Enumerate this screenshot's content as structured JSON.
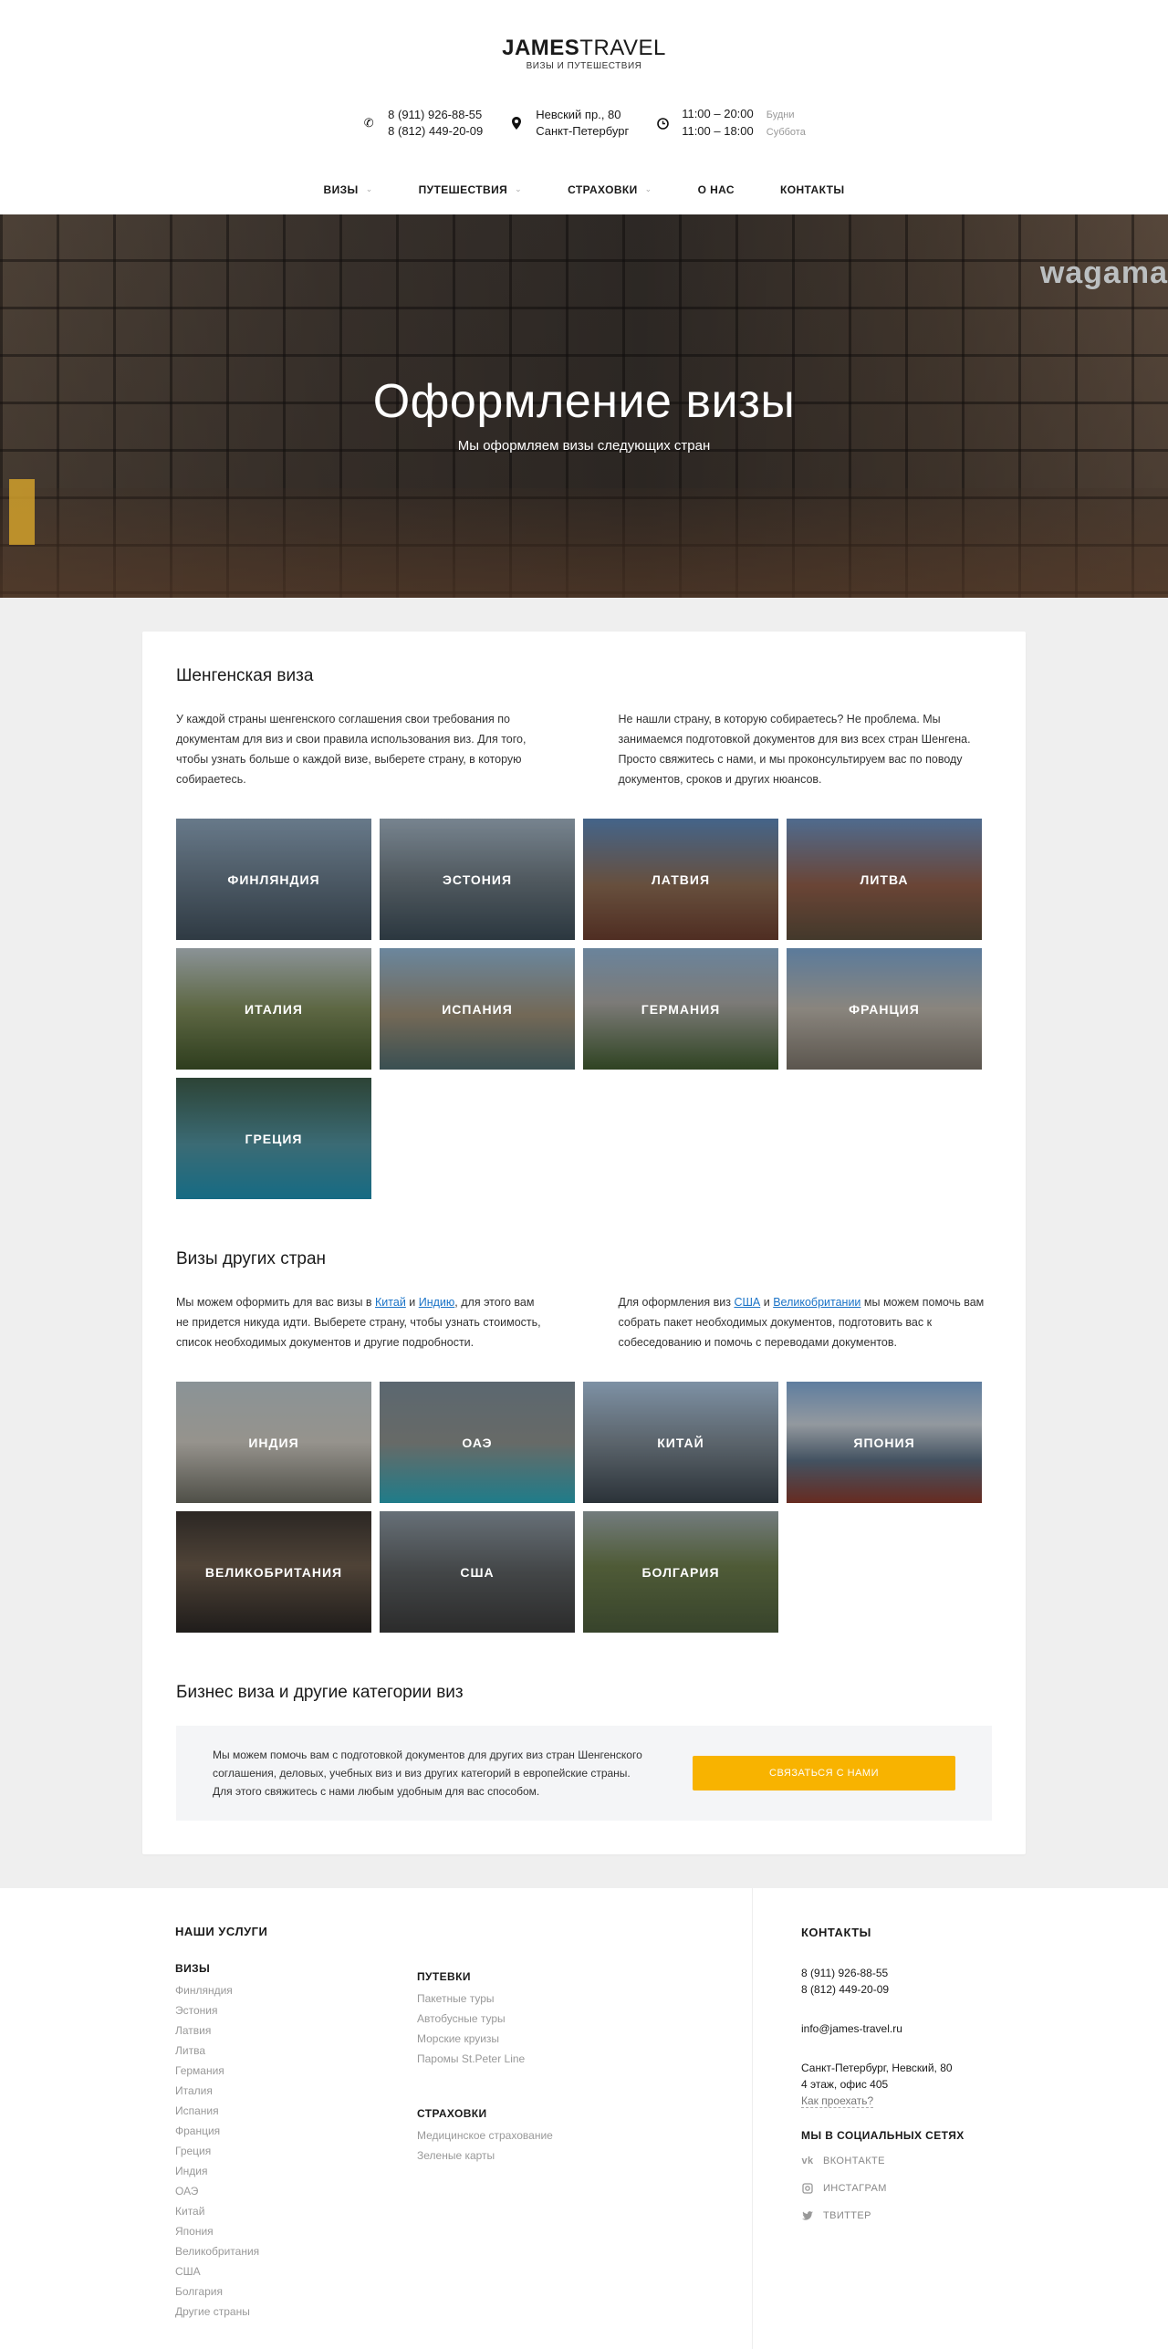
{
  "header": {
    "logo_bold": "JAMES",
    "logo_rest": "TRAVEL",
    "logo_sub": "ВИЗЫ И ПУТЕШЕСТВИЯ",
    "phone1": "8 (911) 926-88-55",
    "phone2": "8 (812) 449-20-09",
    "addr1": "Невский пр., 80",
    "addr2": "Санкт-Петербург",
    "hours1": "11:00 – 20:00",
    "hours1_note": "Будни",
    "hours2": "11:00 – 18:00",
    "hours2_note": "Суббота"
  },
  "nav": [
    {
      "label": "ВИЗЫ",
      "dropdown": true
    },
    {
      "label": "ПУТЕШЕСТВИЯ",
      "dropdown": true
    },
    {
      "label": "СТРАХОВКИ",
      "dropdown": true
    },
    {
      "label": "О НАС",
      "dropdown": false
    },
    {
      "label": "КОНТАКТЫ",
      "dropdown": false
    }
  ],
  "hero": {
    "sign": "wagama",
    "title": "Оформление визы",
    "subtitle": "Мы оформляем визы следующих стран"
  },
  "schengen": {
    "title": "Шенгенская виза",
    "text_left": "У каждой страны шенгенского соглашения свои требования по документам для виз и свои правила использования виз. Для того, чтобы узнать больше о каждой визе, выберете страну, в которую собираетесь.",
    "text_right": "Не нашли страну, в которую собираетесь? Не проблема. Мы занимаемся подготовкой документов для виз всех стран Шенгена. Просто свяжитесь с нами, и мы проконсультируем вас по поводу документов, сроков и других нюансов.",
    "countries": [
      "ФИНЛЯНДИЯ",
      "ЭСТОНИЯ",
      "ЛАТВИЯ",
      "ЛИТВА",
      "ИТАЛИЯ",
      "ИСПАНИЯ",
      "ГЕРМАНИЯ",
      "ФРАНЦИЯ",
      "ГРЕЦИЯ"
    ]
  },
  "other": {
    "title": "Визы других стран",
    "left_pre": "Мы можем оформить для вас визы в ",
    "left_link1": "Китай",
    "left_mid": " и ",
    "left_link2": "Индию",
    "left_post": ", для этого вам не придется никуда идти. Выберете страну, чтобы узнать стоимость, список необходимых документов и другие подробности.",
    "right_pre": "Для оформления виз ",
    "right_link1": "США",
    "right_mid": " и ",
    "right_link2": "Великобритании",
    "right_post": " мы можем помочь вам собрать пакет необходимых документов, подготовить вас к собеседованию и помочь с переводами документов.",
    "countries": [
      "ИНДИЯ",
      "ОАЭ",
      "КИТАЙ",
      "ЯПОНИЯ",
      "ВЕЛИКОБРИТАНИЯ",
      "США",
      "БОЛГАРИЯ"
    ]
  },
  "business": {
    "title": "Бизнес виза и другие категории виз",
    "text": "Мы можем помочь вам с подготовкой документов для других виз стран Шенгенского соглашения, деловых, учебных виз и виз других категорий в европейские страны. Для этого свяжитесь с нами любым удобным для вас способом.",
    "button": "СВЯЗАТЬСЯ С НАМИ"
  },
  "footer": {
    "services_title": "НАШИ УСЛУГИ",
    "visas_title": "ВИЗЫ",
    "visas": [
      "Финляндия",
      "Эстония",
      "Латвия",
      "Литва",
      "Германия",
      "Италия",
      "Испания",
      "Франция",
      "Греция",
      "Индия",
      "ОАЭ",
      "Китай",
      "Япония",
      "Великобритания",
      "США",
      "Болгария",
      "Другие страны"
    ],
    "trips_title": "ПУТЕВКИ",
    "trips": [
      "Пакетные туры",
      "Автобусные туры",
      "Морские круизы",
      "Паромы St.Peter Line"
    ],
    "insurance_title": "СТРАХОВКИ",
    "insurance": [
      "Медицинское страхование",
      "Зеленые карты"
    ],
    "contacts_title": "КОНТАКТЫ",
    "phone1": "8 (911) 926-88-55",
    "phone2": "8 (812) 449-20-09",
    "email": "info@james-travel.ru",
    "address1": "Санкт-Петербург, Невский, 80",
    "address2": "4 этаж, офис 405",
    "route_link": "Как проехать?",
    "social_title": "МЫ В СОЦИАЛЬНЫХ СЕТЯХ",
    "social": [
      {
        "label": "ВКОНТАКТЕ",
        "icon": "vk-icon"
      },
      {
        "label": "ИНСТАГРАМ",
        "icon": "instagram-icon"
      },
      {
        "label": "ТВИТТЕР",
        "icon": "twitter-icon"
      }
    ]
  },
  "colors": {
    "accent": "#f8b300",
    "link": "#1a73c7",
    "page_bg": "#efefef"
  }
}
